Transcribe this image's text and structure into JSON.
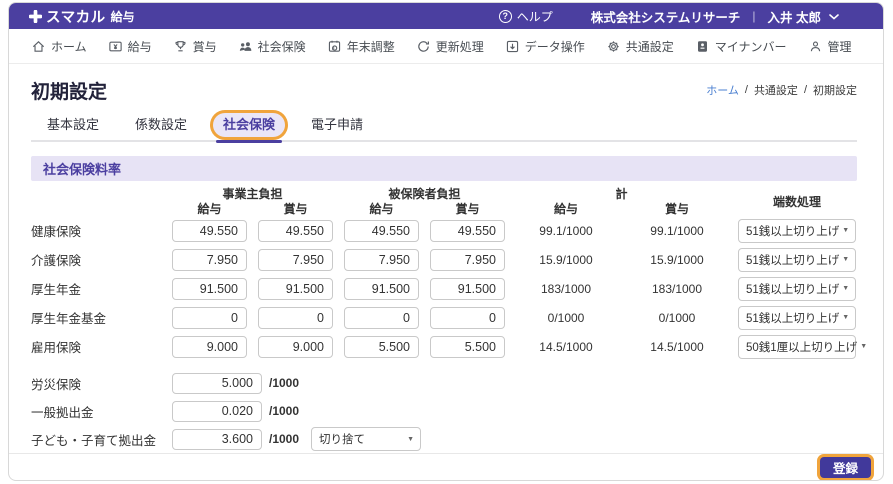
{
  "app": {
    "logo_brand": "スマカル",
    "logo_product": "給与",
    "help_label": "ヘルプ",
    "company_name": "株式会社システムリサーチ",
    "divider": "|",
    "user_name": "入井 太郎"
  },
  "nav": {
    "items": [
      {
        "label": "ホーム",
        "icon": "home-icon"
      },
      {
        "label": "給与",
        "icon": "payroll-icon"
      },
      {
        "label": "賞与",
        "icon": "bonus-trophy-icon"
      },
      {
        "label": "社会保険",
        "icon": "social-insurance-people-icon"
      },
      {
        "label": "年末調整",
        "icon": "year-end-adjustment-icon"
      },
      {
        "label": "更新処理",
        "icon": "update-refresh-icon"
      },
      {
        "label": "データ操作",
        "icon": "data-operation-icon"
      },
      {
        "label": "共通設定",
        "icon": "common-settings-gear-icon"
      },
      {
        "label": "マイナンバー",
        "icon": "my-number-card-icon"
      },
      {
        "label": "管理",
        "icon": "admin-person-icon"
      }
    ]
  },
  "page": {
    "title": "初期設定",
    "breadcrumb": {
      "home": "ホーム",
      "sep1": "/",
      "middle": "共通設定",
      "sep2": "/",
      "current": "初期設定"
    }
  },
  "tabs": {
    "items": [
      {
        "label": "基本設定",
        "active": false
      },
      {
        "label": "係数設定",
        "active": false
      },
      {
        "label": "社会保険",
        "active": true
      },
      {
        "label": "電子申請",
        "active": false
      }
    ]
  },
  "section": {
    "title": "社会保険料率"
  },
  "rate_table": {
    "headers": {
      "employer": "事業主負担",
      "insured": "被保険者負担",
      "total": "計",
      "rounding": "端数処理",
      "salary": "給与",
      "bonus": "賞与"
    },
    "rows": [
      {
        "label": "健康保険",
        "employer_salary": "49.550",
        "employer_bonus": "49.550",
        "insured_salary": "49.550",
        "insured_bonus": "49.550",
        "total_salary": "99.1/1000",
        "total_bonus": "99.1/1000",
        "rounding": "51銭以上切り上げ"
      },
      {
        "label": "介護保険",
        "employer_salary": "7.950",
        "employer_bonus": "7.950",
        "insured_salary": "7.950",
        "insured_bonus": "7.950",
        "total_salary": "15.9/1000",
        "total_bonus": "15.9/1000",
        "rounding": "51銭以上切り上げ"
      },
      {
        "label": "厚生年金",
        "employer_salary": "91.500",
        "employer_bonus": "91.500",
        "insured_salary": "91.500",
        "insured_bonus": "91.500",
        "total_salary": "183/1000",
        "total_bonus": "183/1000",
        "rounding": "51銭以上切り上げ"
      },
      {
        "label": "厚生年金基金",
        "employer_salary": "0",
        "employer_bonus": "0",
        "insured_salary": "0",
        "insured_bonus": "0",
        "total_salary": "0/1000",
        "total_bonus": "0/1000",
        "rounding": "51銭以上切り上げ"
      },
      {
        "label": "雇用保険",
        "employer_salary": "9.000",
        "employer_bonus": "9.000",
        "insured_salary": "5.500",
        "insured_bonus": "5.500",
        "total_salary": "14.5/1000",
        "total_bonus": "14.5/1000",
        "rounding": "50銭1厘以上切り上げ"
      }
    ]
  },
  "simple_rows": [
    {
      "label": "労災保険",
      "value": "5.000",
      "unit": "/1000"
    },
    {
      "label": "一般拠出金",
      "value": "0.020",
      "unit": "/1000"
    },
    {
      "label": "子ども・子育て拠出金",
      "value": "3.600",
      "unit": "/1000",
      "rounding": "切り捨て"
    }
  ],
  "footer": {
    "submit_label": "登録"
  },
  "colors": {
    "brand_purple": "#4b3fa0",
    "highlight_orange": "#f0a43c",
    "link_blue": "#4a7fd0",
    "section_bg": "#e7e3f5",
    "submit_button_bg": "#41399b"
  }
}
